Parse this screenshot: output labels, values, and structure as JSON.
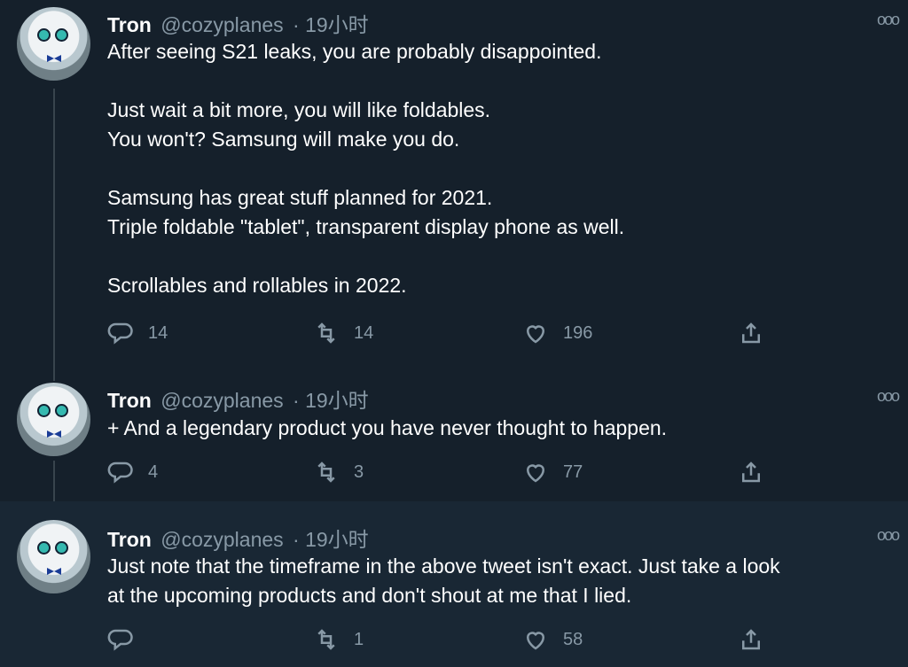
{
  "tweets": [
    {
      "name": "Tron",
      "handle": "@cozyplanes",
      "time": "· 19小时",
      "lines": [
        "After seeing S21 leaks, you are probably disappointed.",
        "",
        "Just wait a bit more, you will like foldables.",
        "You won't? Samsung will make you do.",
        "",
        "Samsung has great stuff planned for 2021.",
        "Triple foldable \"tablet\", transparent display phone as well.",
        "",
        "Scrollables and rollables in 2022."
      ],
      "replies": "14",
      "retweets": "14",
      "likes": "196"
    },
    {
      "name": "Tron",
      "handle": "@cozyplanes",
      "time": "· 19小时",
      "lines": [
        "+ And a legendary product you have never thought to happen."
      ],
      "replies": "4",
      "retweets": "3",
      "likes": "77"
    },
    {
      "name": "Tron",
      "handle": "@cozyplanes",
      "time": "· 19小时",
      "lines": [
        "Just note that the timeframe in the above tweet isn't exact. Just take a look",
        "at the upcoming products and don't shout at me that I lied."
      ],
      "replies": "",
      "retweets": "1",
      "likes": "58"
    }
  ],
  "icons": {
    "reply": "reply-icon",
    "retweet": "retweet-icon",
    "like": "heart-icon",
    "share": "share-icon",
    "more": "more-icon"
  },
  "colors": {
    "background": "#15202b",
    "highlight_background": "#192734",
    "secondary_text": "#8899a6",
    "thread_line": "#38444d"
  }
}
